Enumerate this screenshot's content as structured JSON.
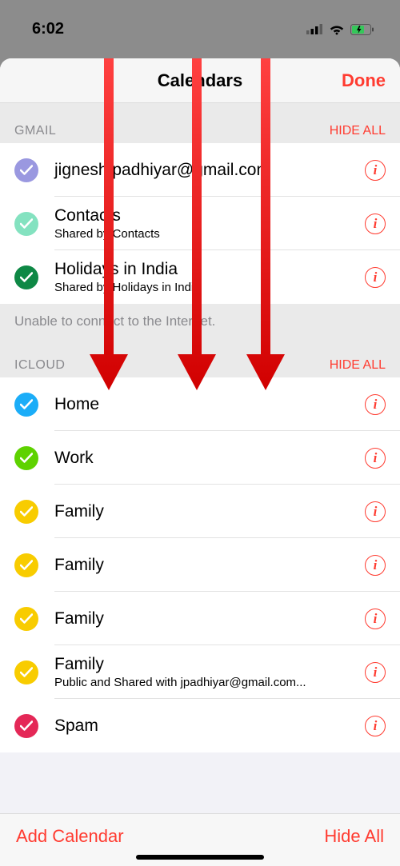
{
  "status": {
    "time": "6:02"
  },
  "header": {
    "title": "Calendars",
    "done": "Done"
  },
  "colors": {
    "lavender": "#9a98e0",
    "mint": "#84e2c0",
    "forest": "#0e8845",
    "blue": "#1badf8",
    "green": "#5ed200",
    "yellow": "#f8cc00",
    "pink": "#e42857"
  },
  "sections": {
    "gmail": {
      "label": "GMAIL",
      "action": "HIDE ALL",
      "items": [
        {
          "title": "jignesh.padhiyar@gmail.com",
          "sub": "",
          "color": "lavender"
        },
        {
          "title": "Contacts",
          "sub": "Shared by Contacts",
          "color": "mint"
        },
        {
          "title": "Holidays in India",
          "sub": "Shared by Holidays in India",
          "color": "forest"
        }
      ]
    },
    "error": "Unable to connect to the Internet.",
    "icloud": {
      "label": "ICLOUD",
      "action": "HIDE ALL",
      "items": [
        {
          "title": "Home",
          "sub": "",
          "color": "blue"
        },
        {
          "title": "Work",
          "sub": "",
          "color": "green"
        },
        {
          "title": "Family",
          "sub": "",
          "color": "yellow"
        },
        {
          "title": "Family",
          "sub": "",
          "color": "yellow"
        },
        {
          "title": "Family",
          "sub": "",
          "color": "yellow"
        },
        {
          "title": "Family",
          "sub": "Public and Shared with jpadhiyar@gmail.com...",
          "color": "yellow"
        },
        {
          "title": "Spam",
          "sub": "",
          "color": "pink"
        }
      ]
    }
  },
  "footer": {
    "add": "Add Calendar",
    "hide": "Hide All"
  }
}
